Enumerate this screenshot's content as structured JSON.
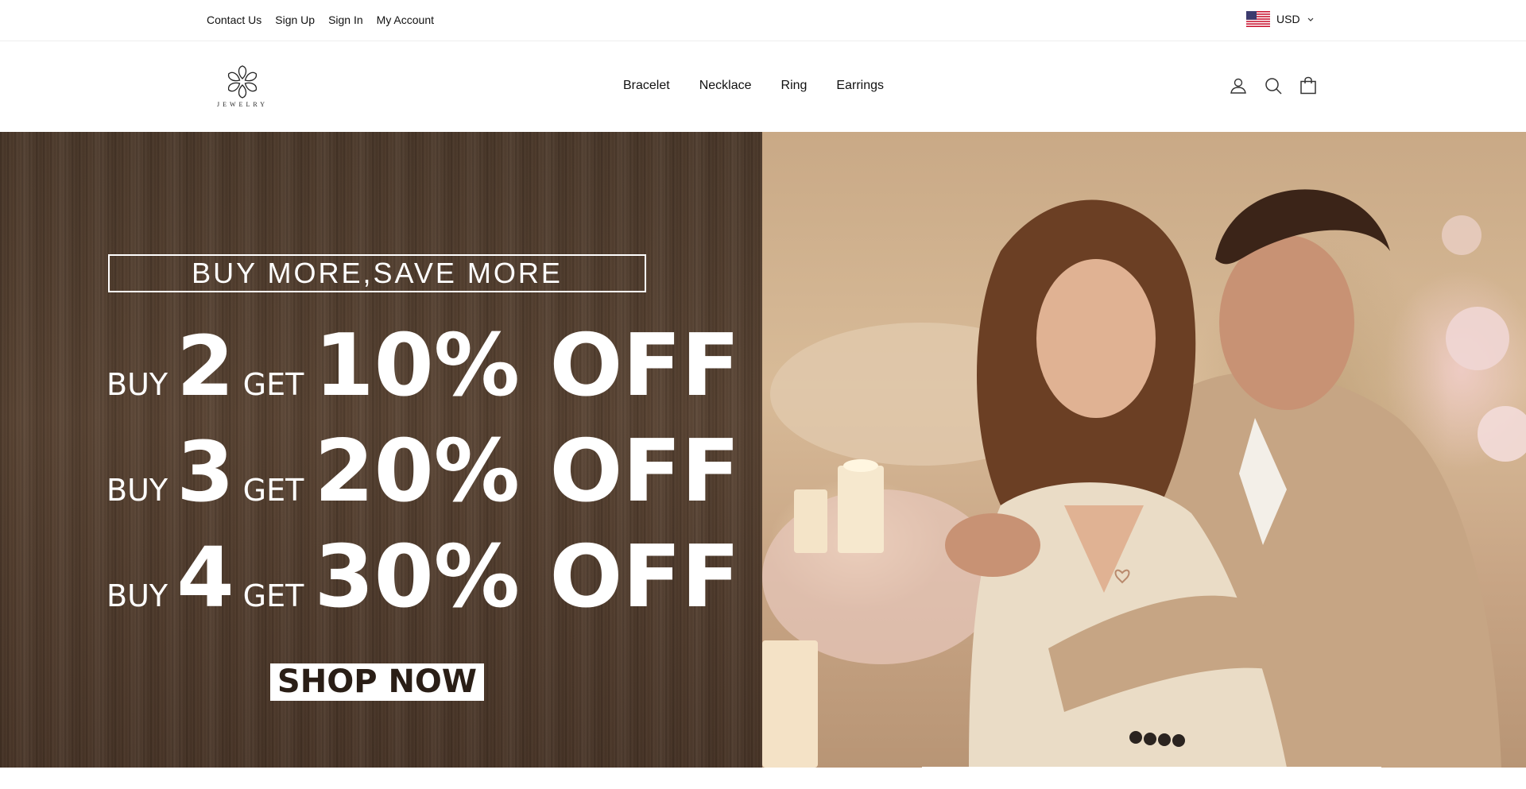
{
  "topbar": {
    "links": [
      "Contact Us",
      "Sign Up",
      "Sign In",
      "My Account"
    ],
    "currency": "USD",
    "currency_icon": "us-flag-icon"
  },
  "header": {
    "logo_text": "JEWELRY",
    "nav": [
      "Bracelet",
      "Necklace",
      "Ring",
      "Earrings"
    ],
    "icons": [
      "user-icon",
      "search-icon",
      "cart-icon"
    ]
  },
  "hero": {
    "promo_title": "BUY MORE,SAVE MORE",
    "offers": [
      {
        "buy": "BUY",
        "qty": "2",
        "get": "GET",
        "discount": "10% OFF"
      },
      {
        "buy": "BUY",
        "qty": "3",
        "get": "GET",
        "discount": "20% OFF"
      },
      {
        "buy": "BUY",
        "qty": "4",
        "get": "GET",
        "discount": "30% OFF"
      }
    ],
    "cta": "SHOP NOW"
  },
  "colors": {
    "hero_wood": "#4d3a2b",
    "hero_text": "#ffffff",
    "cta_text": "#2a1e16"
  }
}
